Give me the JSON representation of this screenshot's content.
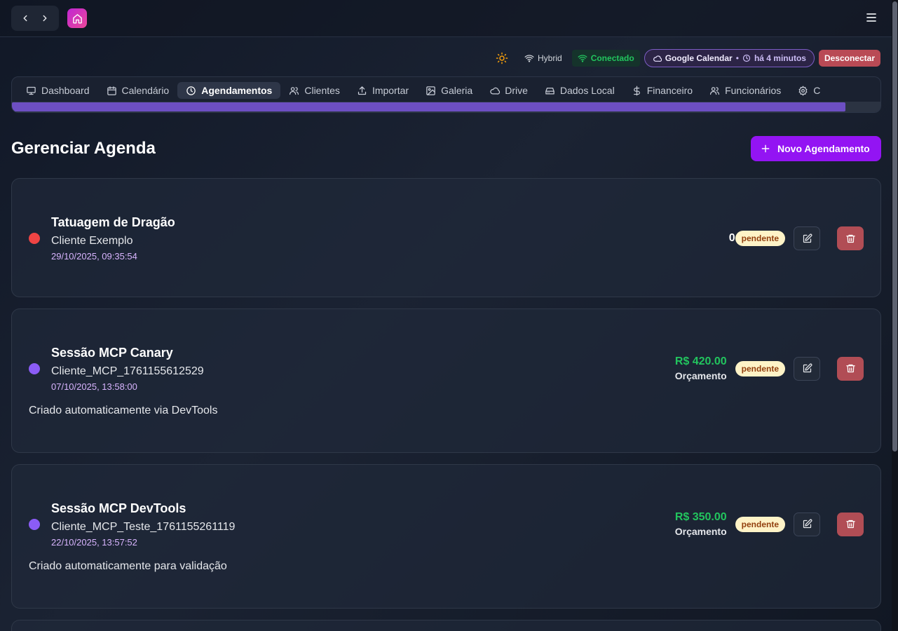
{
  "status": {
    "mode": "Hybrid",
    "connection": "Conectado",
    "google": "Google Calendar",
    "google_sep": "•",
    "google_ago": "há 4 minutos",
    "disconnect": "Desconectar"
  },
  "tabs": [
    {
      "label": "Dashboard",
      "icon": "monitor-icon"
    },
    {
      "label": "Calendário",
      "icon": "calendar-icon"
    },
    {
      "label": "Agendamentos",
      "icon": "clock-icon",
      "active": true
    },
    {
      "label": "Clientes",
      "icon": "users-icon"
    },
    {
      "label": "Importar",
      "icon": "upload-icon"
    },
    {
      "label": "Galeria",
      "icon": "image-icon"
    },
    {
      "label": "Drive",
      "icon": "cloud-icon"
    },
    {
      "label": "Dados Local",
      "icon": "hard-drive-icon"
    },
    {
      "label": "Financeiro",
      "icon": "dollar-icon"
    },
    {
      "label": "Funcionários",
      "icon": "users-icon"
    },
    {
      "label": "C",
      "icon": "gear-icon"
    }
  ],
  "tabs_scroll": {
    "position_fraction": 0.96
  },
  "page": {
    "title": "Gerenciar Agenda",
    "new_button": "Novo Agendamento"
  },
  "appointments": [
    {
      "title": "Tatuagem de Dragão",
      "client": "Cliente Exemplo",
      "datetime": "29/10/2025, 09:35:54",
      "amount": "0",
      "status": "pendente",
      "dot_color": "#ef4444"
    },
    {
      "title": "Sessão MCP Canary",
      "client": "Cliente_MCP_1761155612529",
      "datetime": "07/10/2025, 13:58:00",
      "price": "R$ 420.00",
      "price_label": "Orçamento",
      "status": "pendente",
      "description": "Criado automaticamente via DevTools",
      "dot_color": "#8b5cf6"
    },
    {
      "title": "Sessão MCP DevTools",
      "client": "Cliente_MCP_Teste_1761155261119",
      "datetime": "22/10/2025, 13:57:52",
      "price": "R$ 350.00",
      "price_label": "Orçamento",
      "status": "pendente",
      "description": "Criado automaticamente para validação",
      "dot_color": "#8b5cf6"
    }
  ]
}
